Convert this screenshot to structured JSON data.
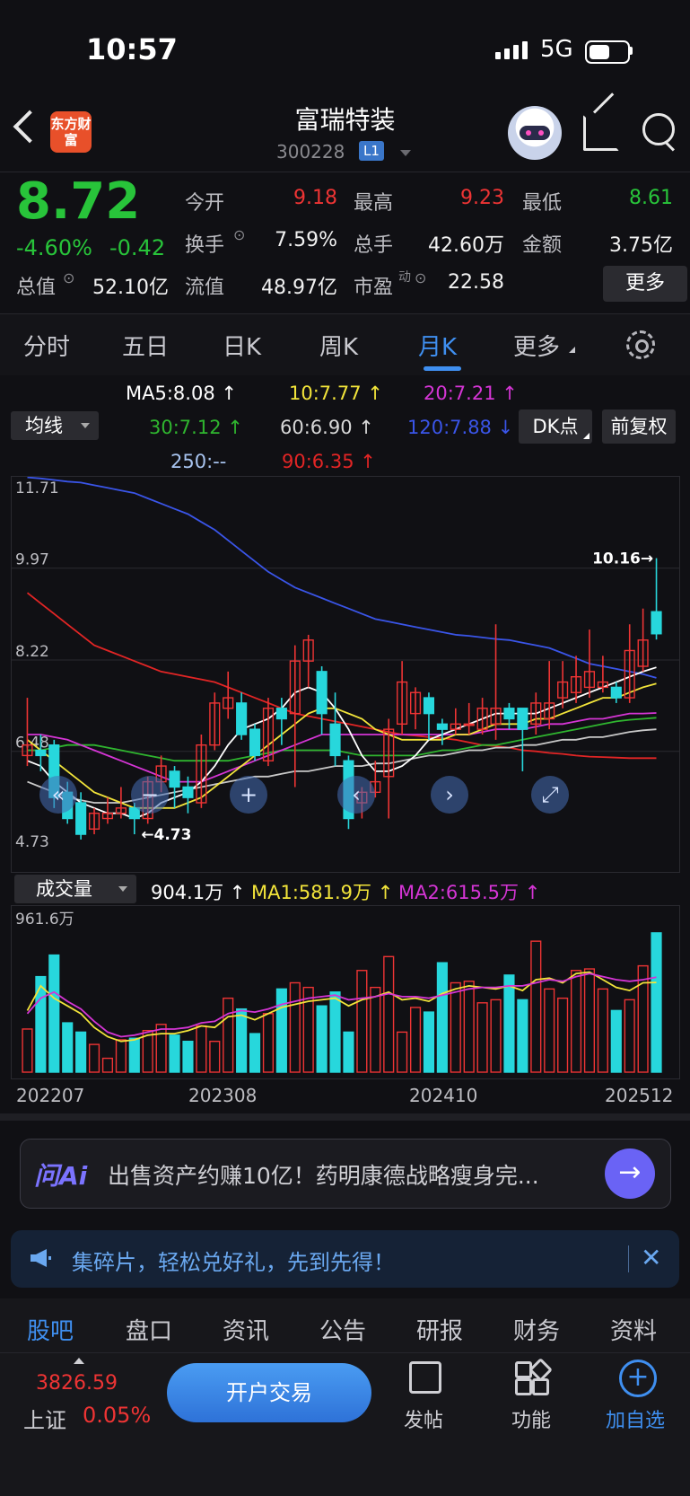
{
  "status": {
    "time": "10:57",
    "network": "5G"
  },
  "header": {
    "name": "富瑞特装",
    "code": "300228",
    "level": "L1",
    "logo_text": "东方财富"
  },
  "quote": {
    "price": "8.72",
    "pct": "-4.60%",
    "change": "-0.42",
    "open_label": "今开",
    "open": "9.18",
    "high_label": "最高",
    "high": "9.23",
    "low_label": "最低",
    "low": "8.61",
    "turnover_label": "换手",
    "turnover": "7.59%",
    "volume_label": "总手",
    "volume": "42.60万",
    "amount_label": "金额",
    "amount": "3.75亿",
    "mktcap_label": "总值",
    "mktcap": "52.10亿",
    "float_label": "流值",
    "float": "48.97亿",
    "pe_label": "市盈",
    "pe_sup": "动",
    "pe": "22.58",
    "more": "更多"
  },
  "tabs": [
    "分时",
    "五日",
    "日K",
    "周K",
    "月K",
    "更多"
  ],
  "active_tab": "月K",
  "ma": {
    "dropdown": "均线",
    "ma5": "MA5:8.08 ↑",
    "ma10": "10:7.77 ↑",
    "ma20": "20:7.21 ↑",
    "ma30": "30:7.12 ↑",
    "ma60": "60:6.90 ↑",
    "ma120": "120:7.88 ↓",
    "ma250": "250:--",
    "ma90": "90:6.35 ↑",
    "dk": "DK点",
    "fq": "前复权"
  },
  "colors": {
    "up": "#ee3434",
    "down": "#27d7dc",
    "ma5": "#ffffff",
    "ma10": "#f2e43a",
    "ma20": "#d535d5",
    "ma30": "#2fb52f",
    "ma60": "#c8c8c8",
    "ma120": "#3a55e8",
    "ma90": "#e22525"
  },
  "chart_data": [
    {
      "type": "candlestick",
      "title": "",
      "y_ticks": [
        "11.71",
        "9.97",
        "8.22",
        "6.48",
        "4.73"
      ],
      "ylim": [
        4.73,
        11.71
      ],
      "max_label": "10.16→",
      "min_label": "←4.73",
      "candles": [
        [
          6.4,
          6.6,
          7.5,
          6.2
        ],
        [
          6.5,
          6.4,
          6.8,
          6.1
        ],
        [
          6.6,
          5.6,
          6.7,
          5.4
        ],
        [
          5.7,
          5.2,
          5.9,
          5.1
        ],
        [
          5.5,
          4.9,
          5.7,
          4.8
        ],
        [
          5.0,
          5.3,
          5.4,
          4.9
        ],
        [
          5.2,
          5.3,
          5.6,
          5.1
        ],
        [
          5.3,
          5.4,
          5.8,
          5.2
        ],
        [
          5.4,
          5.2,
          5.5,
          4.9
        ],
        [
          5.2,
          5.9,
          6.0,
          5.1
        ],
        [
          5.9,
          6.2,
          6.4,
          5.7
        ],
        [
          6.1,
          5.8,
          6.2,
          5.4
        ],
        [
          5.8,
          5.6,
          6.0,
          5.3
        ],
        [
          5.5,
          6.6,
          6.8,
          5.4
        ],
        [
          6.6,
          7.4,
          7.6,
          6.5
        ],
        [
          7.3,
          7.5,
          8.0,
          7.1
        ],
        [
          7.4,
          6.8,
          7.6,
          6.7
        ],
        [
          6.9,
          6.4,
          7.0,
          6.3
        ],
        [
          6.3,
          7.3,
          7.5,
          6.2
        ],
        [
          7.3,
          7.1,
          7.5,
          6.6
        ],
        [
          7.2,
          8.2,
          8.5,
          5.8
        ],
        [
          8.2,
          8.6,
          8.7,
          7.7
        ],
        [
          8.0,
          7.2,
          8.1,
          6.8
        ],
        [
          7.0,
          6.4,
          7.6,
          6.2
        ],
        [
          6.3,
          5.2,
          6.4,
          5.0
        ],
        [
          5.5,
          5.7,
          5.8,
          5.2
        ],
        [
          5.7,
          5.9,
          6.3,
          5.6
        ],
        [
          6.0,
          6.9,
          7.1,
          5.2
        ],
        [
          7.0,
          7.8,
          8.2,
          6.8
        ],
        [
          7.2,
          7.6,
          7.7,
          6.9
        ],
        [
          7.5,
          7.2,
          7.6,
          6.7
        ],
        [
          7.0,
          6.9,
          7.1,
          6.6
        ],
        [
          6.9,
          7.0,
          7.3,
          6.8
        ],
        [
          7.0,
          7.0,
          7.4,
          6.8
        ],
        [
          6.9,
          7.3,
          7.5,
          6.8
        ],
        [
          7.0,
          7.3,
          8.9,
          6.7
        ],
        [
          7.3,
          7.1,
          7.4,
          6.9
        ],
        [
          7.3,
          6.9,
          7.3,
          6.1
        ],
        [
          7.0,
          7.4,
          7.6,
          6.8
        ],
        [
          7.1,
          7.4,
          8.2,
          6.9
        ],
        [
          7.5,
          7.8,
          8.2,
          7.3
        ],
        [
          7.6,
          7.9,
          8.3,
          7.4
        ],
        [
          7.7,
          8.0,
          8.8,
          7.5
        ],
        [
          7.7,
          7.8,
          8.3,
          7.6
        ],
        [
          7.7,
          7.5,
          7.8,
          7.4
        ],
        [
          7.5,
          8.4,
          8.9,
          7.4
        ],
        [
          8.1,
          8.6,
          9.2,
          8.0
        ],
        [
          9.14,
          8.72,
          10.16,
          8.61
        ]
      ],
      "ma_lines": {
        "ma5": [
          6.3,
          6.2,
          5.9,
          5.7,
          5.5,
          5.4,
          5.3,
          5.3,
          5.2,
          5.3,
          5.5,
          5.6,
          5.7,
          5.9,
          6.2,
          6.6,
          6.9,
          7.0,
          7.1,
          7.3,
          7.6,
          7.7,
          7.6,
          7.3,
          6.9,
          6.4,
          6.1,
          6.1,
          6.2,
          6.4,
          6.7,
          6.8,
          6.9,
          7.0,
          7.1,
          7.2,
          7.2,
          7.2,
          7.2,
          7.3,
          7.4,
          7.5,
          7.6,
          7.7,
          7.8,
          7.9,
          8.0,
          8.08
        ],
        "ma10": [
          6.7,
          6.5,
          6.3,
          6.1,
          5.9,
          5.7,
          5.6,
          5.5,
          5.4,
          5.4,
          5.4,
          5.4,
          5.5,
          5.6,
          5.8,
          6.0,
          6.2,
          6.4,
          6.6,
          6.8,
          7.0,
          7.2,
          7.3,
          7.3,
          7.2,
          7.1,
          6.9,
          6.8,
          6.7,
          6.7,
          6.7,
          6.7,
          6.8,
          6.8,
          6.9,
          7.0,
          7.0,
          7.0,
          7.1,
          7.1,
          7.2,
          7.3,
          7.4,
          7.5,
          7.5,
          7.6,
          7.7,
          7.77
        ],
        "ma20": [
          6.8,
          6.8,
          6.75,
          6.7,
          6.6,
          6.5,
          6.4,
          6.3,
          6.2,
          6.1,
          6.0,
          5.9,
          5.9,
          5.9,
          6.0,
          6.1,
          6.2,
          6.3,
          6.4,
          6.5,
          6.6,
          6.7,
          6.8,
          6.8,
          6.8,
          6.8,
          6.8,
          6.8,
          6.8,
          6.8,
          6.8,
          6.8,
          6.8,
          6.8,
          6.85,
          6.9,
          6.9,
          6.9,
          6.95,
          7.0,
          7.0,
          7.05,
          7.1,
          7.1,
          7.15,
          7.2,
          7.2,
          7.21
        ],
        "ma30": [
          6.5,
          6.5,
          6.55,
          6.6,
          6.6,
          6.6,
          6.55,
          6.5,
          6.45,
          6.4,
          6.35,
          6.3,
          6.3,
          6.3,
          6.3,
          6.3,
          6.35,
          6.4,
          6.45,
          6.5,
          6.5,
          6.5,
          6.5,
          6.5,
          6.45,
          6.4,
          6.4,
          6.4,
          6.4,
          6.4,
          6.45,
          6.5,
          6.5,
          6.55,
          6.6,
          6.6,
          6.65,
          6.7,
          6.75,
          6.8,
          6.85,
          6.9,
          6.95,
          7.0,
          7.05,
          7.08,
          7.1,
          7.12
        ],
        "ma60": [
          5.9,
          5.8,
          5.7,
          5.6,
          5.55,
          5.5,
          5.5,
          5.5,
          5.55,
          5.6,
          5.65,
          5.7,
          5.75,
          5.8,
          5.85,
          5.9,
          5.95,
          6.0,
          6.0,
          6.05,
          6.1,
          6.1,
          6.15,
          6.2,
          6.2,
          6.2,
          6.25,
          6.25,
          6.3,
          6.35,
          6.4,
          6.4,
          6.45,
          6.5,
          6.5,
          6.55,
          6.55,
          6.6,
          6.6,
          6.65,
          6.7,
          6.7,
          6.75,
          6.75,
          6.8,
          6.85,
          6.88,
          6.9
        ],
        "ma90": [
          9.5,
          9.3,
          9.1,
          8.9,
          8.7,
          8.5,
          8.4,
          8.3,
          8.2,
          8.1,
          8.0,
          7.95,
          7.9,
          7.85,
          7.8,
          7.7,
          7.6,
          7.5,
          7.4,
          7.3,
          7.2,
          7.15,
          7.1,
          7.05,
          7.0,
          6.95,
          6.9,
          6.85,
          6.8,
          6.78,
          6.75,
          6.73,
          6.7,
          6.65,
          6.6,
          6.58,
          6.55,
          6.5,
          6.48,
          6.45,
          6.43,
          6.4,
          6.38,
          6.37,
          6.36,
          6.35,
          6.35,
          6.35
        ],
        "ma120": [
          11.7,
          11.68,
          11.65,
          11.62,
          11.6,
          11.55,
          11.5,
          11.45,
          11.4,
          11.3,
          11.2,
          11.1,
          11.0,
          10.85,
          10.7,
          10.5,
          10.3,
          10.1,
          9.9,
          9.75,
          9.6,
          9.5,
          9.4,
          9.3,
          9.2,
          9.1,
          9.0,
          8.95,
          8.9,
          8.85,
          8.8,
          8.75,
          8.7,
          8.68,
          8.65,
          8.62,
          8.6,
          8.55,
          8.5,
          8.45,
          8.35,
          8.25,
          8.15,
          8.1,
          8.05,
          8.0,
          7.95,
          7.88
        ]
      }
    },
    {
      "type": "bar",
      "title": "成交量",
      "ymax_label": "961.6万",
      "current": "904.1万 ↑",
      "ma1": "MA1:581.9万 ↑",
      "ma2": "MA2:615.5万 ↑",
      "x_ticks": [
        "202207",
        "202308",
        "202410",
        "202512"
      ],
      "values": [
        280,
        620,
        760,
        320,
        260,
        180,
        90,
        210,
        220,
        270,
        310,
        240,
        200,
        300,
        200,
        480,
        410,
        250,
        380,
        540,
        580,
        550,
        430,
        520,
        260,
        660,
        550,
        750,
        260,
        420,
        390,
        710,
        580,
        590,
        450,
        470,
        630,
        470,
        850,
        540,
        480,
        660,
        670,
        540,
        400,
        470,
        690,
        904
      ],
      "ma1_line": [
        400,
        560,
        480,
        430,
        380,
        290,
        230,
        200,
        210,
        240,
        250,
        250,
        270,
        300,
        290,
        360,
        370,
        340,
        380,
        420,
        440,
        460,
        470,
        480,
        430,
        470,
        490,
        520,
        470,
        480,
        460,
        510,
        540,
        560,
        550,
        540,
        560,
        530,
        600,
        610,
        580,
        640,
        650,
        600,
        550,
        530,
        580,
        582
      ],
      "ma2_line": [
        380,
        480,
        520,
        460,
        410,
        330,
        260,
        230,
        240,
        260,
        280,
        280,
        290,
        320,
        330,
        380,
        400,
        390,
        410,
        440,
        460,
        480,
        490,
        500,
        470,
        480,
        490,
        510,
        490,
        490,
        480,
        500,
        520,
        540,
        550,
        550,
        560,
        560,
        580,
        600,
        590,
        620,
        640,
        620,
        600,
        590,
        600,
        616
      ]
    }
  ],
  "ai": {
    "logo": "问Ai",
    "text": "出售资产约赚10亿！药明康德战略瘦身完..."
  },
  "promo": {
    "text": "集碎片，轻松兑好礼，先到先得！"
  },
  "bottom_tabs": [
    "股吧",
    "盘口",
    "资讯",
    "公告",
    "研报",
    "财务",
    "资料"
  ],
  "index": {
    "value": "3826.59",
    "name": "上证",
    "pct": "0.05%"
  },
  "actions": {
    "trade": "开户交易",
    "post": "发帖",
    "func": "功能",
    "add": "加自选"
  }
}
